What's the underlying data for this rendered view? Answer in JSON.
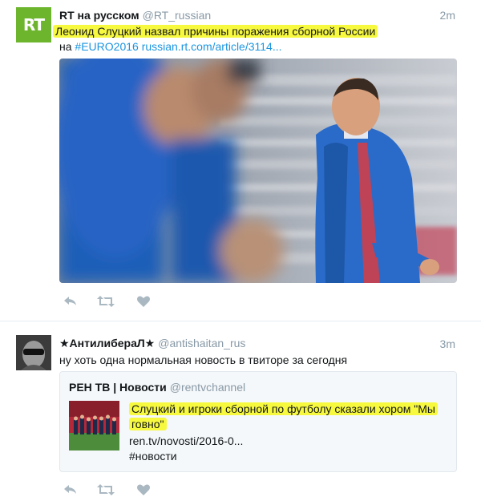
{
  "tweet1": {
    "avatar": {
      "icon": "rt-logo",
      "text": "RT"
    },
    "name": "RT на русском",
    "handle": "@RT_russian",
    "time": "2m",
    "text_highlight": "Леонид Слуцкий назвал причины поражения сборной России",
    "text_prefix": "на",
    "hashtag": "#EURO2016",
    "link": "russian.rt.com/article/3114...",
    "actions": [
      "reply-icon",
      "retweet-icon",
      "like-icon"
    ]
  },
  "tweet2": {
    "name": "★АнтилибераЛ★",
    "handle": "@antishaitan_rus",
    "time": "3m",
    "text": "ну хоть одна нормальная новость в твиторе за сегодня",
    "quote": {
      "name": "РЕН ТВ | Новости",
      "handle": "@rentvchannel",
      "line1": "Слуцкий и игроки сборной по футболу сказали хором \"Мы",
      "line2": "говно\"",
      "link": "ren.tv/novosti/2016-0...",
      "hashtag": "#новости"
    },
    "actions": [
      "reply-icon",
      "retweet-icon",
      "like-icon"
    ]
  },
  "colors": {
    "highlight": "#f7f93f",
    "link": "#1b95e0",
    "muted": "#8899a6",
    "rt_green": "#6cb52d"
  }
}
